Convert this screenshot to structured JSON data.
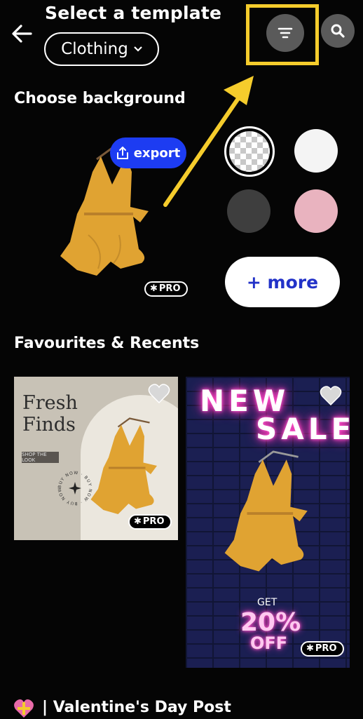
{
  "header": {
    "title": "Select a template",
    "category": "Clothing",
    "back_icon": "arrow-left-icon",
    "filter_icon": "filter-icon",
    "search_icon": "search-icon"
  },
  "annotation": {
    "highlight_color": "#f5cc2c"
  },
  "background_section": {
    "title": "Choose background",
    "export_label": "export",
    "pro_label": "PRO",
    "swatches": [
      {
        "name": "transparent",
        "color": "checker"
      },
      {
        "name": "white",
        "color": "#f4f4f4"
      },
      {
        "name": "dark-gray",
        "color": "#3e3e3e"
      },
      {
        "name": "pink",
        "color": "#e9b3bf"
      }
    ],
    "more_label": "+ more"
  },
  "favourites": {
    "title": "Favourites & Recents",
    "cards": [
      {
        "title_line1": "Fresh",
        "title_line2": "Finds",
        "button": "SHOP THE LOOK",
        "stamp": "BUY NOW",
        "pro": "PRO"
      },
      {
        "headline1": "NEW",
        "headline2": "SALE",
        "get": "GET",
        "discount": "20%",
        "off": "OFF",
        "pro": "PRO"
      }
    ]
  },
  "next_section": {
    "title": "| Valentine's Day Post"
  },
  "colors": {
    "accent_blue": "#1d3cf2",
    "more_text": "#2232c8",
    "dress": "#e0a332"
  }
}
